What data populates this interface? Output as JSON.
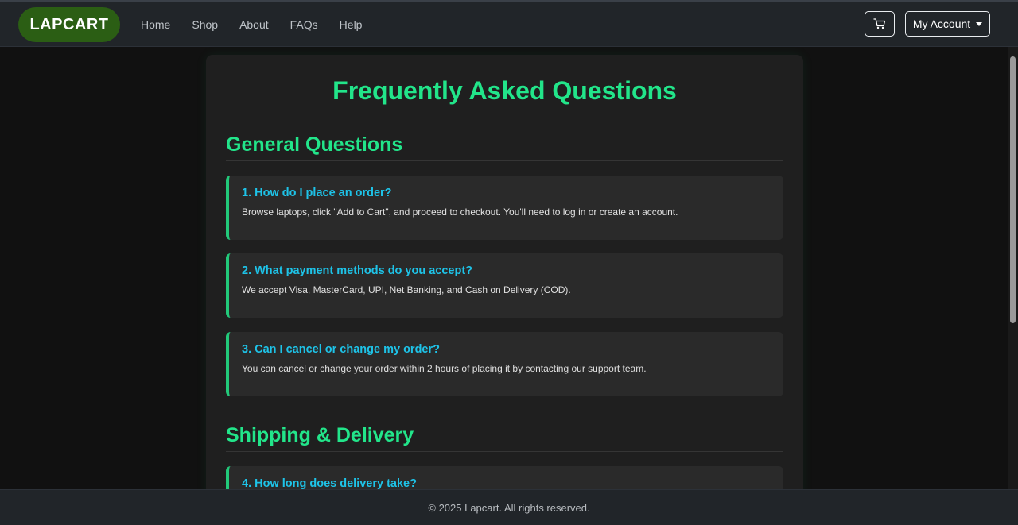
{
  "navbar": {
    "brand": "LAPCART",
    "links": [
      "Home",
      "Shop",
      "About",
      "FAQs",
      "Help"
    ],
    "cart_icon": "cart-icon",
    "account_label": "My Account"
  },
  "main": {
    "title": "Frequently Asked Questions",
    "sections": [
      {
        "title": "General Questions",
        "items": [
          {
            "question": "1. How do I place an order?",
            "answer": "Browse laptops, click \"Add to Cart\", and proceed to checkout. You'll need to log in or create an account."
          },
          {
            "question": "2. What payment methods do you accept?",
            "answer": "We accept Visa, MasterCard, UPI, Net Banking, and Cash on Delivery (COD)."
          },
          {
            "question": "3. Can I cancel or change my order?",
            "answer": "You can cancel or change your order within 2 hours of placing it by contacting our support team."
          }
        ]
      },
      {
        "title": "Shipping & Delivery",
        "items": [
          {
            "question": "4. How long does delivery take?",
            "answer": ""
          }
        ]
      }
    ]
  },
  "footer": {
    "text": "© 2025 Lapcart. All rights reserved."
  },
  "colors": {
    "accent_green": "#22e58a",
    "question_blue": "#1ec3e8",
    "brand_bg": "#2b5e14",
    "navbar_bg": "#212529"
  }
}
